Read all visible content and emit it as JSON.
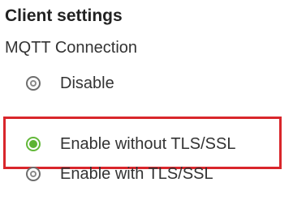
{
  "section": {
    "title": "Client settings"
  },
  "mqtt": {
    "group_label": "MQTT Connection",
    "options": [
      {
        "label": "Disable",
        "selected": false
      },
      {
        "label": "Enable without TLS/SSL",
        "selected": true
      },
      {
        "label": "Enable with TLS/SSL",
        "selected": false
      }
    ]
  },
  "colors": {
    "selected_radio": "#5db334",
    "highlight_border": "#d9262b"
  }
}
